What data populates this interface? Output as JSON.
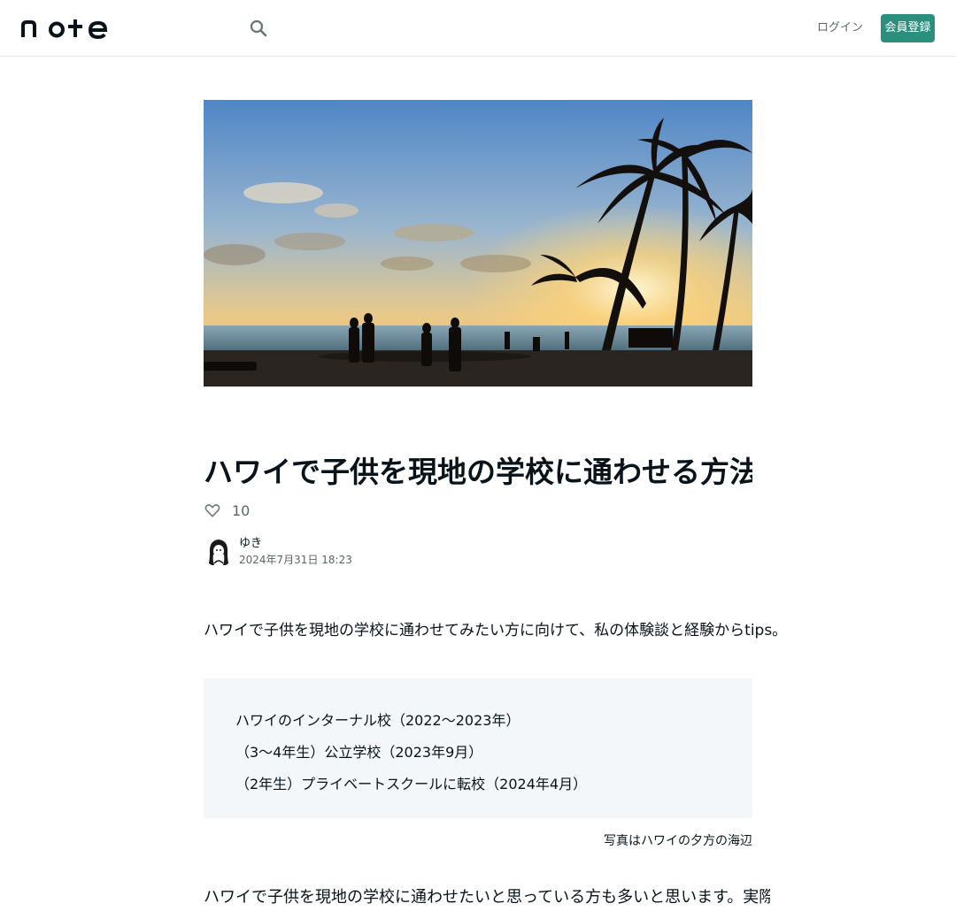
{
  "header": {
    "logo_text": "note",
    "search_icon": "search-icon",
    "login_label": "ログイン",
    "signup_label": "会員登録",
    "accent_color": "#2a8f7c"
  },
  "article": {
    "hero_image": "beach-sunset-photo",
    "title": "ハワイで子供を現地の学校に通わせる方法と体験談",
    "like_icon": "heart-outline-icon",
    "like_count": "10",
    "author_name": "ゆき",
    "date": "2024年7月31日 18:23",
    "lead": "ハワイで子供を現地の学校に通わせてみたい方に向けて、私の体験談と経験からtips。",
    "toc": [
      "ハワイのインターナル校（2022〜2023年）",
      "（3〜4年生）公立学校（2023年9月）",
      "（2年生）プライベートスクールに転校（2024年4月）"
    ],
    "caption": "写真はハワイの夕方の海辺",
    "body_first_line": "ハワイで子供を現地の学校に通わせたいと思っている方も多いと思います。実際に私の経験をもとにまとめてみました。"
  }
}
